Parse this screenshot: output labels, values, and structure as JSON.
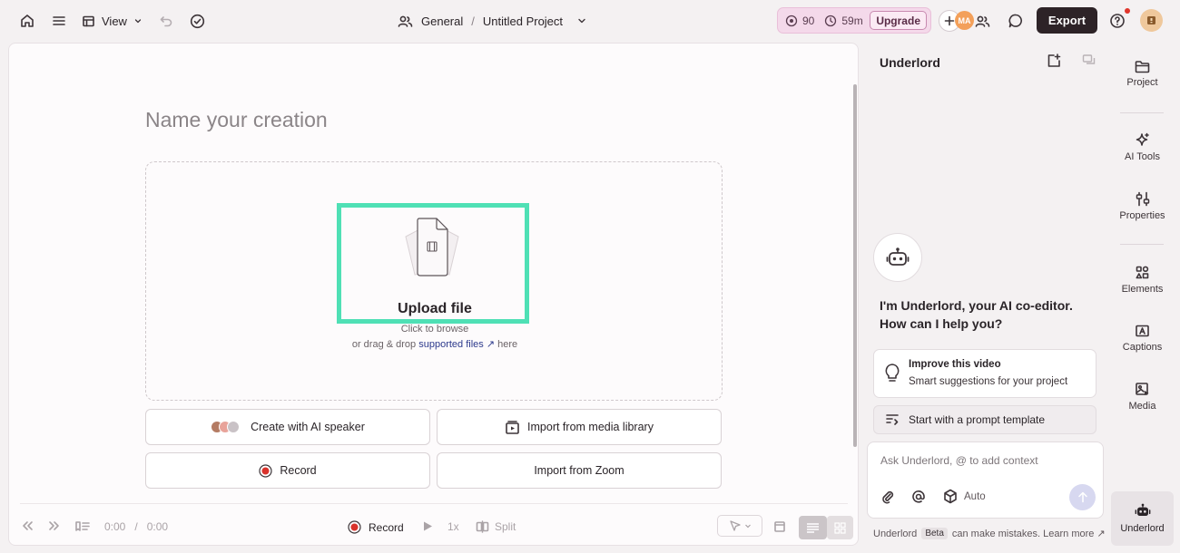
{
  "topbar": {
    "view_label": "View",
    "workspace": "General",
    "separator": "/",
    "project": "Untitled Project",
    "usage_credits": "90",
    "usage_minutes": "59m",
    "upgrade_label": "Upgrade",
    "collaborator_initials": "MA",
    "export_label": "Export"
  },
  "canvas": {
    "name_placeholder": "Name your creation",
    "upload_title": "Upload file",
    "upload_sub1": "Click to browse",
    "upload_sub2_pre": "or drag & drop",
    "upload_sub2_link": "supported files ↗",
    "upload_sub2_post": "here",
    "options": {
      "ai_speaker": "Create with AI speaker",
      "media_library": "Import from media library",
      "record": "Record",
      "zoom": "Import from Zoom"
    }
  },
  "transport": {
    "time_current": "0:00",
    "time_sep": "/",
    "time_total": "0:00",
    "record_label": "Record",
    "speed": "1x",
    "split_label": "Split"
  },
  "panel": {
    "title": "Underlord",
    "greeting": "I'm Underlord, your AI co-editor. How can I help you?",
    "suggestion_title": "Improve this video",
    "suggestion_sub": "Smart suggestions for your project",
    "template_label": "Start with a prompt template",
    "chat_placeholder": "Ask Underlord, @ to add context",
    "mode_label": "Auto",
    "disclaimer_name": "Underlord",
    "beta_label": "Beta",
    "disclaimer_text": "can make mistakes. Learn more ↗"
  },
  "rail": {
    "project": "Project",
    "ai_tools": "AI Tools",
    "properties": "Properties",
    "elements": "Elements",
    "captions": "Captions",
    "media": "Media",
    "underlord": "Underlord"
  },
  "colors": {
    "accent_highlight": "#4fe0b5",
    "export_bg": "#2d2327",
    "usage_bg": "#f4d9ea",
    "record_red": "#d9322b"
  }
}
